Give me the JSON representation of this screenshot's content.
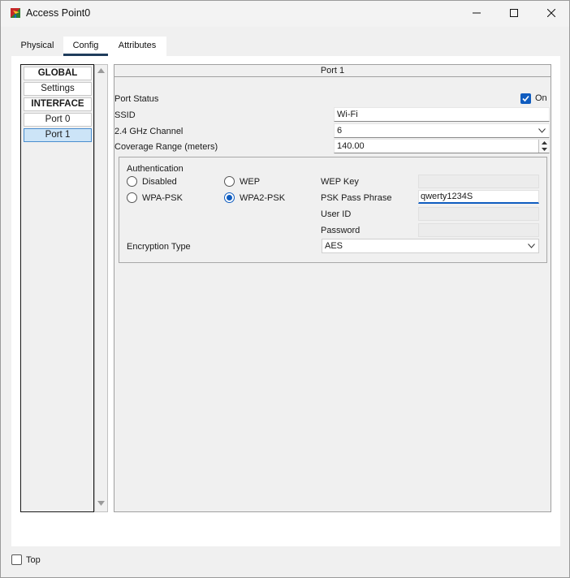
{
  "window": {
    "title": "Access Point0",
    "icon": "access-point-icon",
    "controls": [
      "minimize-icon",
      "maximize-icon",
      "close-icon"
    ]
  },
  "tabs": [
    {
      "label": "Physical",
      "active": false
    },
    {
      "label": "Config",
      "active": true
    },
    {
      "label": "Attributes",
      "active": false
    }
  ],
  "nav": {
    "items": [
      {
        "label": "GLOBAL",
        "type": "header"
      },
      {
        "label": "Settings",
        "type": "item"
      },
      {
        "label": "INTERFACE",
        "type": "header"
      },
      {
        "label": "Port 0",
        "type": "item"
      },
      {
        "label": "Port 1",
        "type": "item",
        "selected": true
      }
    ]
  },
  "port": {
    "title": "Port 1",
    "port_status_label": "Port Status",
    "port_status_checkbox_label": "On",
    "port_status_on": true,
    "ssid_label": "SSID",
    "ssid_value": "Wi-Fi",
    "channel_label": "2.4 GHz Channel",
    "channel_value": "6",
    "coverage_label": "Coverage Range (meters)",
    "coverage_value": "140.00"
  },
  "auth": {
    "title": "Authentication",
    "options": [
      {
        "label": "Disabled",
        "checked": false
      },
      {
        "label": "WEP",
        "checked": false
      },
      {
        "label": "WPA-PSK",
        "checked": false
      },
      {
        "label": "WPA2-PSK",
        "checked": true
      }
    ],
    "wep_key_label": "WEP Key",
    "wep_key_value": "",
    "psk_label": "PSK Pass Phrase",
    "psk_value": "qwerty1234S",
    "user_id_label": "User ID",
    "user_id_value": "",
    "password_label": "Password",
    "password_value": "",
    "encryption_label": "Encryption Type",
    "encryption_value": "AES"
  },
  "footer": {
    "top_label": "Top",
    "top_checked": false
  },
  "colors": {
    "accent": "#0f5cbf",
    "selected_bg": "#cce4f7",
    "tab_underline": "#1f3d5c"
  }
}
